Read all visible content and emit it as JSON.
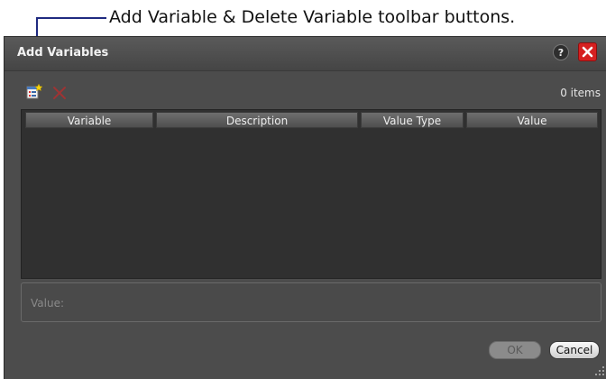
{
  "annotation": {
    "text": "Add Variable & Delete Variable toolbar buttons."
  },
  "dialog": {
    "title": "Add Variables",
    "help_label": "?",
    "toolbar": {
      "item_count": "0 items"
    },
    "table": {
      "columns": [
        "Variable",
        "Description",
        "Value Type",
        "Value"
      ],
      "rows": []
    },
    "value_field": {
      "label": "Value:"
    },
    "buttons": {
      "ok": "OK",
      "cancel": "Cancel"
    }
  },
  "colors": {
    "dialog_bg": "#4c4c4c",
    "table_bg": "#303030",
    "close_red": "#d62020",
    "delete_icon_red": "#9e3434",
    "annotation_line": "#1f2a80"
  }
}
